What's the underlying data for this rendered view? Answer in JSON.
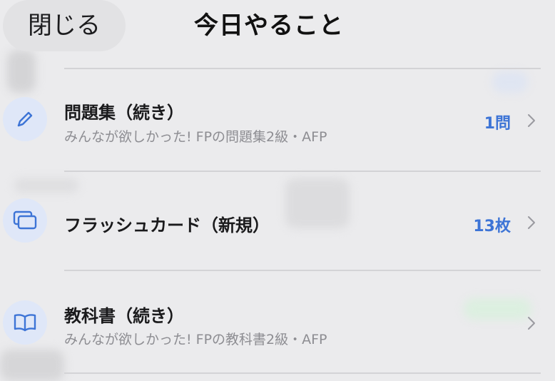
{
  "header": {
    "close_label": "閉じる",
    "title": "今日やること"
  },
  "rows": [
    {
      "icon": "pencil-icon",
      "title": "問題集（続き）",
      "subtitle": "みんなが欲しかった! FPの問題集2級・AFP",
      "count": "1問"
    },
    {
      "icon": "cards-icon",
      "title": "フラッシュカード（新規）",
      "subtitle": "",
      "count": "13枚"
    },
    {
      "icon": "book-icon",
      "title": "教科書（続き）",
      "subtitle": "みんなが欲しかった! FPの教科書2級・AFP",
      "count": ""
    }
  ],
  "colors": {
    "accent": "#3d74d6",
    "icon_background": "#dfe7f8",
    "background": "#ebebed"
  }
}
